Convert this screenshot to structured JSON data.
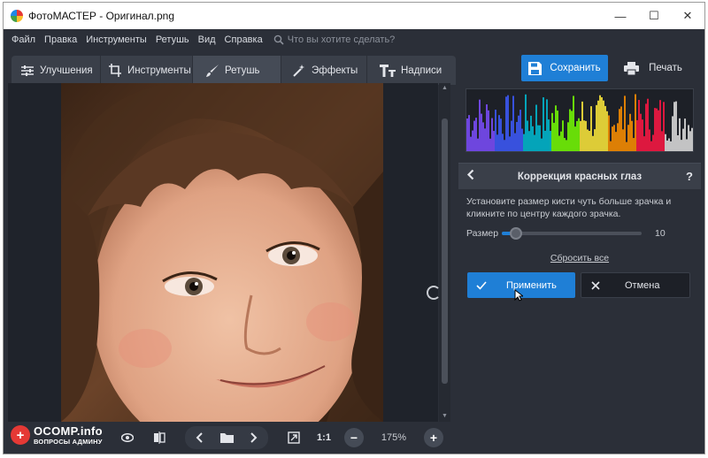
{
  "window": {
    "title": "ФотоМАСТЕР - Оригинал.png",
    "controls": {
      "minimize": "—",
      "maximize": "☐",
      "close": "✕"
    }
  },
  "menu": {
    "items": [
      "Файл",
      "Правка",
      "Инструменты",
      "Ретушь",
      "Вид",
      "Справка"
    ],
    "search_placeholder": "Что вы хотите сделать?"
  },
  "tabs": [
    {
      "label": "Улучшения",
      "icon": "sliders-icon",
      "active": false
    },
    {
      "label": "Инструменты",
      "icon": "crop-icon",
      "active": false
    },
    {
      "label": "Ретушь",
      "icon": "brush-icon",
      "active": true
    },
    {
      "label": "Эффекты",
      "icon": "magic-wand-icon",
      "active": false
    },
    {
      "label": "Надписи",
      "icon": "text-icon",
      "active": false
    }
  ],
  "toolbar": {
    "save_label": "Сохранить",
    "print_label": "Печать"
  },
  "panel": {
    "title": "Коррекция красных глаз",
    "help": "?",
    "description": "Установите размер кисти чуть больше зрачка и кликните по центру каждого зрачка.",
    "slider": {
      "label": "Размер",
      "value": "10",
      "fraction": 0.1
    },
    "reset_link": "Сбросить все",
    "apply_label": "Применить",
    "cancel_label": "Отмена"
  },
  "bottom": {
    "zoom_fit": "1:1",
    "zoom_level": "175%"
  },
  "watermark": {
    "brand": "OCOMP.info",
    "sub": "ВОПРОСЫ АДМИНУ",
    "badge": "+"
  },
  "colors": {
    "accent": "#1f7fd6",
    "background": "#2b2f38",
    "panel": "#3a3f49"
  }
}
